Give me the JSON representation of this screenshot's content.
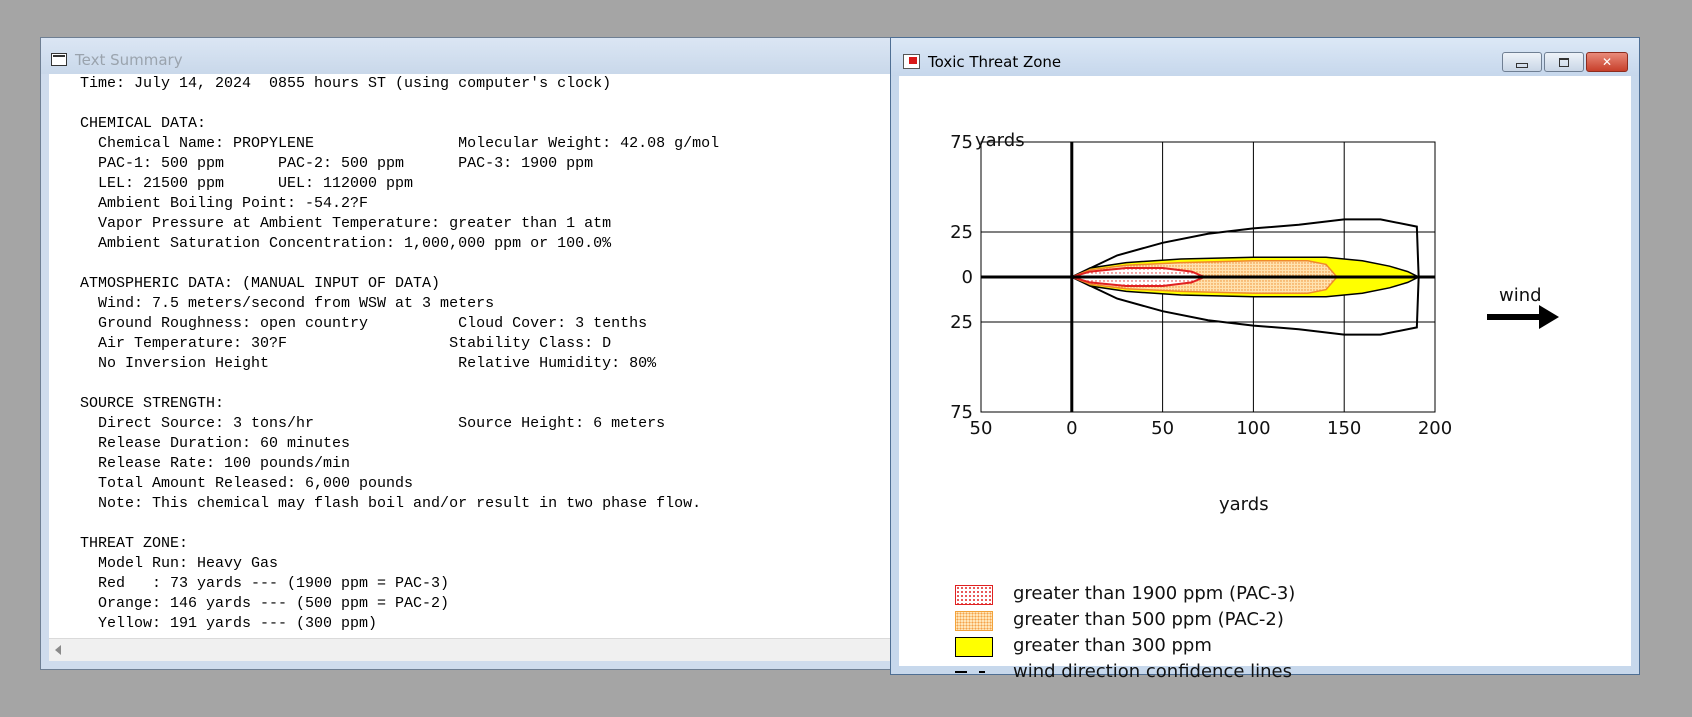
{
  "text_summary": {
    "title": "Text Summary",
    "lines": [
      "Time: July 14, 2024  0855 hours ST (using computer's clock)",
      "",
      "CHEMICAL DATA:",
      "  Chemical Name: PROPYLENE                Molecular Weight: 42.08 g/mol",
      "  PAC-1: 500 ppm      PAC-2: 500 ppm      PAC-3: 1900 ppm",
      "  LEL: 21500 ppm      UEL: 112000 ppm",
      "  Ambient Boiling Point: -54.2?F",
      "  Vapor Pressure at Ambient Temperature: greater than 1 atm",
      "  Ambient Saturation Concentration: 1,000,000 ppm or 100.0%",
      "",
      "ATMOSPHERIC DATA: (MANUAL INPUT OF DATA)",
      "  Wind: 7.5 meters/second from WSW at 3 meters",
      "  Ground Roughness: open country          Cloud Cover: 3 tenths",
      "  Air Temperature: 30?F                  Stability Class: D",
      "  No Inversion Height                     Relative Humidity: 80%",
      "",
      "SOURCE STRENGTH:",
      "  Direct Source: 3 tons/hr                Source Height: 6 meters",
      "  Release Duration: 60 minutes",
      "  Release Rate: 100 pounds/min",
      "  Total Amount Released: 6,000 pounds",
      "  Note: This chemical may flash boil and/or result in two phase flow.",
      "",
      "THREAT ZONE:",
      "  Model Run: Heavy Gas",
      "  Red   : 73 yards --- (1900 ppm = PAC-3)",
      "  Orange: 146 yards --- (500 ppm = PAC-2)",
      "  Yellow: 191 yards --- (300 ppm)"
    ]
  },
  "threat_zone": {
    "title": "Toxic Threat Zone",
    "window_buttons": {
      "minimize": "minimize",
      "maximize": "maximize",
      "close": "close"
    },
    "wind_label": "wind",
    "legend": [
      {
        "label": "greater than 1900 ppm (PAC-3)",
        "color": "#e02020"
      },
      {
        "label": "greater than 500 ppm (PAC-2)",
        "color": "#f4a24a"
      },
      {
        "label": "greater than 300 ppm",
        "color": "#ffff00"
      },
      {
        "label": "wind direction confidence lines",
        "color": "#000000"
      }
    ]
  },
  "chart_data": {
    "type": "area",
    "xlabel": "yards",
    "ylabel": "yards",
    "xlim": [
      -50,
      200
    ],
    "ylim": [
      -75,
      75
    ],
    "x_ticks": [
      -50,
      0,
      50,
      100,
      150,
      200
    ],
    "x_tick_labels": [
      "50",
      "0",
      "50",
      "100",
      "150",
      "200"
    ],
    "y_ticks": [
      75,
      25,
      0,
      -25,
      -75
    ],
    "y_tick_labels": [
      "75",
      "25",
      "0",
      "25",
      "75"
    ],
    "grid": true,
    "series": [
      {
        "name": "greater than 300 ppm",
        "color": "#ffff00",
        "upper": [
          [
            0,
            0
          ],
          [
            10,
            5
          ],
          [
            30,
            8
          ],
          [
            60,
            10
          ],
          [
            100,
            11
          ],
          [
            140,
            11
          ],
          [
            160,
            9
          ],
          [
            175,
            6
          ],
          [
            185,
            3
          ],
          [
            191,
            0
          ]
        ],
        "lower": [
          [
            0,
            0
          ],
          [
            10,
            -5
          ],
          [
            30,
            -8
          ],
          [
            60,
            -10
          ],
          [
            100,
            -11
          ],
          [
            140,
            -11
          ],
          [
            160,
            -9
          ],
          [
            175,
            -6
          ],
          [
            185,
            -3
          ],
          [
            191,
            0
          ]
        ]
      },
      {
        "name": "greater than 500 ppm (PAC-2)",
        "color": "#f4a24a",
        "upper": [
          [
            0,
            0
          ],
          [
            10,
            4
          ],
          [
            30,
            6.5
          ],
          [
            60,
            8
          ],
          [
            100,
            9
          ],
          [
            130,
            9
          ],
          [
            140,
            7
          ],
          [
            146,
            0
          ]
        ],
        "lower": [
          [
            0,
            0
          ],
          [
            10,
            -4
          ],
          [
            30,
            -6.5
          ],
          [
            60,
            -8
          ],
          [
            100,
            -9
          ],
          [
            130,
            -9
          ],
          [
            140,
            -7
          ],
          [
            146,
            0
          ]
        ]
      },
      {
        "name": "greater than 1900 ppm (PAC-3)",
        "color": "#e02020",
        "upper": [
          [
            0,
            0
          ],
          [
            10,
            3
          ],
          [
            30,
            5
          ],
          [
            50,
            5
          ],
          [
            66,
            3
          ],
          [
            73,
            0
          ]
        ],
        "lower": [
          [
            0,
            0
          ],
          [
            10,
            -3
          ],
          [
            30,
            -5
          ],
          [
            50,
            -5
          ],
          [
            66,
            -3
          ],
          [
            73,
            0
          ]
        ]
      },
      {
        "name": "wind direction confidence lines",
        "color": "#000000",
        "upper": [
          [
            0,
            0
          ],
          [
            25,
            12
          ],
          [
            50,
            19
          ],
          [
            75,
            24
          ],
          [
            100,
            27
          ],
          [
            125,
            29
          ],
          [
            150,
            32
          ],
          [
            170,
            32
          ],
          [
            190,
            28
          ],
          [
            191,
            0
          ]
        ],
        "lower": [
          [
            0,
            0
          ],
          [
            25,
            -12
          ],
          [
            50,
            -19
          ],
          [
            75,
            -24
          ],
          [
            100,
            -27
          ],
          [
            125,
            -29
          ],
          [
            150,
            -32
          ],
          [
            170,
            -32
          ],
          [
            190,
            -28
          ],
          [
            191,
            0
          ]
        ]
      }
    ]
  }
}
